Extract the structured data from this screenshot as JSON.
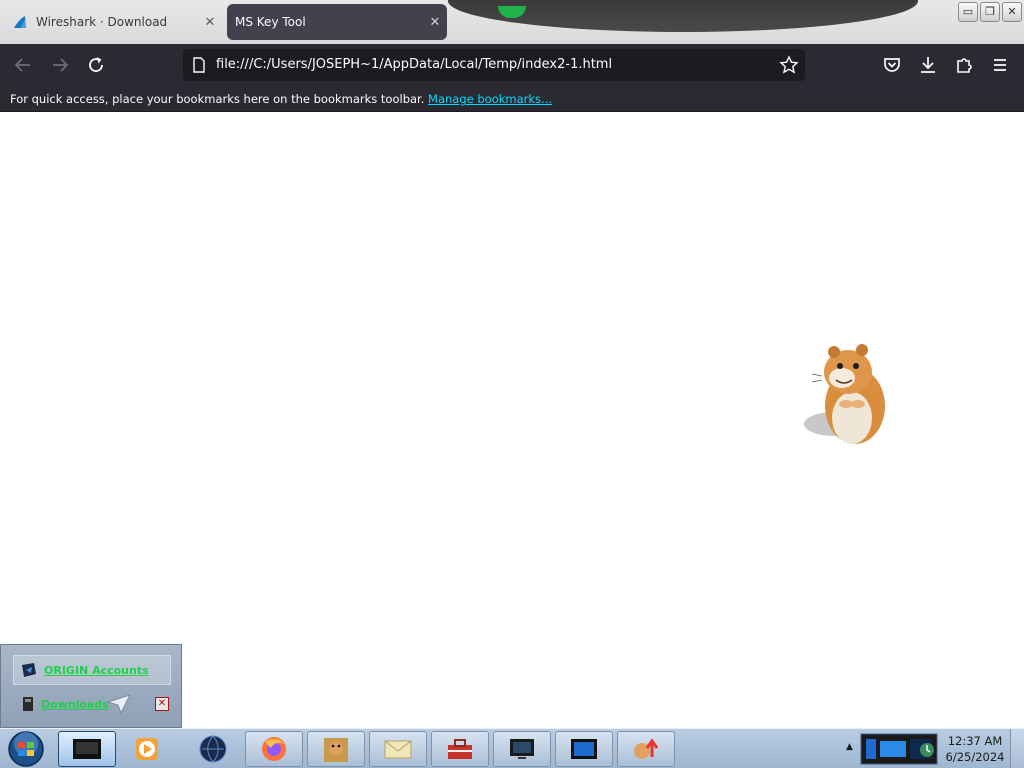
{
  "browser": {
    "tabs": [
      {
        "label": "Wireshark · Download",
        "active": false,
        "icon": "wireshark-fin-icon"
      },
      {
        "label": "MS Key Tool",
        "active": true,
        "icon": null
      }
    ],
    "tab_close_glyph": "✕",
    "url": "file:///C:/Users/JOSEPH~1/AppData/Local/Temp/index2-1.html",
    "bookmarks_bar": {
      "message": "For quick access, place your bookmarks here on the bookmarks toolbar.",
      "link": "Manage bookmarks..."
    },
    "toolbar_icons": [
      "back-arrow-icon",
      "forward-arrow-icon",
      "reload-icon",
      "page-icon",
      "star-bookmark-icon",
      "pocket-icon",
      "download-icon",
      "extensions-icon",
      "menu-hamburger-icon"
    ]
  },
  "window_controls": {
    "minimize": "▭",
    "restore": "❐",
    "close": "✕"
  },
  "content": {
    "image": "hamster-character"
  },
  "widget": {
    "rows": [
      {
        "label": "ORIGIN Accounts",
        "icon": "shield-arrow-icon"
      },
      {
        "label": "Downloads",
        "icon": "notebook-icon"
      }
    ],
    "close_glyph": "✕"
  },
  "taskbar": {
    "items": [
      "terminal-app",
      "media-player-app",
      "globe-app",
      "firefox-app",
      "box-app",
      "mail-app",
      "toolbox-app",
      "monitor-app",
      "screen-app",
      "upload-app"
    ],
    "tray_arrow": "▲",
    "clock": {
      "time": "12:37 AM",
      "date": "6/25/2024"
    }
  },
  "colors": {
    "dark_chrome": "#2b2a33",
    "urlbar": "#1c1b22",
    "active_tab": "#42414d",
    "link": "#00ddff",
    "taskbar": "#a8bfd8"
  }
}
